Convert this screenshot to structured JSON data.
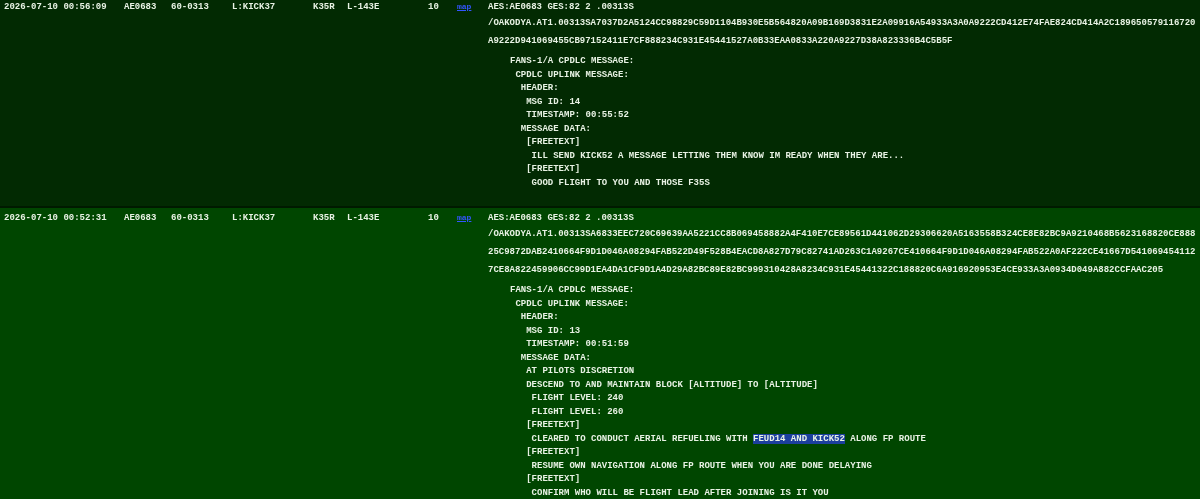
{
  "messages": [
    {
      "timestamp": "2026-07-10 00:56:09",
      "aes_id": "AE0683",
      "registration": "60-0313",
      "callsign": "L:KICK37",
      "aircraft_type": "K35R",
      "column_6": "L-143E",
      "column_7": "10",
      "map_link": "map",
      "selected": false,
      "header": "AES:AE0683 GES:82 2 .00313S",
      "raw": "/OAKODYA.AT1.00313SA7037D2A5124CC98829C59D1104B930E5B564820A09B169D3831E2A09916A54933A3A0A9222CD412E74FAE824CD414A2C189650579116720A9222D941069455CB97152411E7CF888234C931E45441527A0B33EAA0833A220A9227D38A823336B4C5B5F",
      "decoded": [
        {
          "text": "FANS-1/A CPDLC MESSAGE:",
          "children": [
            {
              "text": "CPDLC UPLINK MESSAGE:",
              "children": [
                {
                  "text": "HEADER:",
                  "children": [
                    {
                      "text": "MSG ID: 14"
                    },
                    {
                      "text": "TIMESTAMP: 00:55:52"
                    }
                  ]
                },
                {
                  "text": "MESSAGE DATA:",
                  "children": [
                    {
                      "text": "[FREETEXT]",
                      "children": [
                        {
                          "text": "ILL SEND KICK52 A MESSAGE LETTING THEM KNOW IM READY WHEN THEY ARE..."
                        }
                      ]
                    },
                    {
                      "text": "[FREETEXT]",
                      "children": [
                        {
                          "text": "GOOD FLIGHT TO YOU AND THOSE F35S"
                        }
                      ]
                    }
                  ]
                }
              ]
            }
          ]
        }
      ]
    },
    {
      "timestamp": "2026-07-10 00:52:31",
      "aes_id": "AE0683",
      "registration": "60-0313",
      "callsign": "L:KICK37",
      "aircraft_type": "K35R",
      "column_6": "L-143E",
      "column_7": "10",
      "map_link": "map",
      "selected": true,
      "header": "AES:AE0683 GES:82 2 .00313S",
      "raw": "/OAKODYA.AT1.00313SA6833EEC720C69639AA5221CC8B069458882A4F410E7CE89561D441062D29306620A5163558B324CE8E82BC9A9210468B5623168820CE88825C9872DAB2410664F9D1D046A08294FAB522D49F528B4EACD8A827D79C82741AD263C1A9267CE410664F9D1D046A08294FAB522A0AF222CE41667D5410694541127CE8A822459906CC99D1EA4DA1CF9D1A4D29A82BC89E82BC999310428A8234C931E45441322C188820C6A916920953E4CE933A3A0934D049A882CCFAAC205",
      "decoded": [
        {
          "text": "FANS-1/A CPDLC MESSAGE:",
          "children": [
            {
              "text": "CPDLC UPLINK MESSAGE:",
              "children": [
                {
                  "text": "HEADER:",
                  "children": [
                    {
                      "text": "MSG ID: 13"
                    },
                    {
                      "text": "TIMESTAMP: 00:51:59"
                    }
                  ]
                },
                {
                  "text": "MESSAGE DATA:",
                  "children": [
                    {
                      "text": "AT PILOTS DISCRETION"
                    },
                    {
                      "text": "DESCEND TO AND MAINTAIN BLOCK [ALTITUDE] TO [ALTITUDE]",
                      "children": [
                        {
                          "text": "FLIGHT LEVEL: 240"
                        },
                        {
                          "text": "FLIGHT LEVEL: 260"
                        }
                      ]
                    },
                    {
                      "text": "[FREETEXT]",
                      "children": [
                        {
                          "segments": [
                            {
                              "text": "CLEARED TO CONDUCT AERIAL REFUELING WITH ",
                              "selected": false
                            },
                            {
                              "text": "FEUD14 AND KICK52",
                              "selected": true
                            },
                            {
                              "text": " ALONG FP ROUTE",
                              "selected": false
                            }
                          ]
                        }
                      ]
                    },
                    {
                      "text": "[FREETEXT]",
                      "children": [
                        {
                          "text": "RESUME OWN NAVIGATION ALONG FP ROUTE WHEN YOU ARE DONE DELAYING"
                        }
                      ]
                    },
                    {
                      "text": "[FREETEXT]",
                      "children": [
                        {
                          "text": "CONFIRM WHO WILL BE FLIGHT LEAD AFTER JOINING IS IT YOU"
                        }
                      ]
                    }
                  ]
                }
              ]
            }
          ]
        }
      ]
    }
  ]
}
